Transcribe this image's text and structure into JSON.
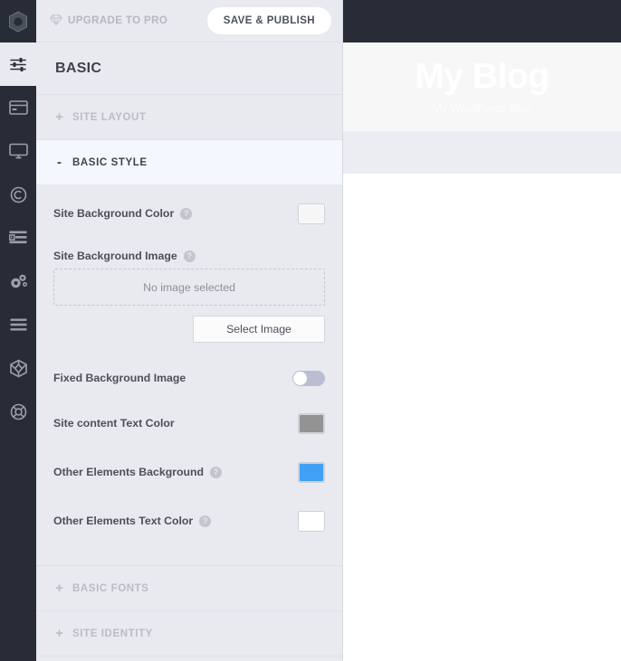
{
  "rail": {
    "logo_icon": "hexagon-logo-icon",
    "items": [
      {
        "name": "sliders-icon",
        "label": "Customize",
        "active": true
      },
      {
        "name": "credit-card-icon",
        "label": "Header",
        "active": false
      },
      {
        "name": "desktop-monitor-icon",
        "label": "Layout",
        "active": false
      },
      {
        "name": "copyright-icon",
        "label": "Footer",
        "active": false
      },
      {
        "name": "list-text-icon",
        "label": "Blog",
        "active": false
      },
      {
        "name": "gears-icon",
        "label": "Settings",
        "active": false
      },
      {
        "name": "hamburger-menu-icon",
        "label": "Menus",
        "active": false
      },
      {
        "name": "cube-icon",
        "label": "Modules",
        "active": false
      },
      {
        "name": "lifebuoy-icon",
        "label": "Support",
        "active": false
      }
    ]
  },
  "topbar": {
    "upgrade_label": "UPGRADE TO PRO",
    "upgrade_icon": "diamond-icon",
    "save_label": "SAVE & PUBLISH"
  },
  "panel": {
    "title": "BASIC",
    "sections": [
      {
        "id": "site-layout",
        "label": "SITE LAYOUT",
        "sign": "+",
        "open": false
      },
      {
        "id": "basic-style",
        "label": "BASIC STYLE",
        "sign": "-",
        "open": true
      },
      {
        "id": "basic-fonts",
        "label": "BASIC FONTS",
        "sign": "+",
        "open": false
      },
      {
        "id": "site-identity",
        "label": "SITE IDENTITY",
        "sign": "+",
        "open": false
      }
    ],
    "fields": {
      "site_bg_color": {
        "label": "Site Background Color",
        "help": "?",
        "value": "#f6f6f7"
      },
      "site_bg_image": {
        "label": "Site Background Image",
        "help": "?",
        "empty_text": "No image selected",
        "select_label": "Select Image"
      },
      "fixed_bg_image": {
        "label": "Fixed Background Image",
        "state": "off"
      },
      "site_content_text_color": {
        "label": "Site content Text Color",
        "value": "#939393"
      },
      "other_elements_background": {
        "label": "Other Elements Background",
        "help": "?",
        "value": "#3fa0f5"
      },
      "other_elements_text_color": {
        "label": "Other Elements Text Color",
        "help": "?",
        "value": "#ffffff"
      }
    }
  },
  "preview": {
    "site_title": "My Blog",
    "site_tagline": "My WordPress Blog"
  }
}
